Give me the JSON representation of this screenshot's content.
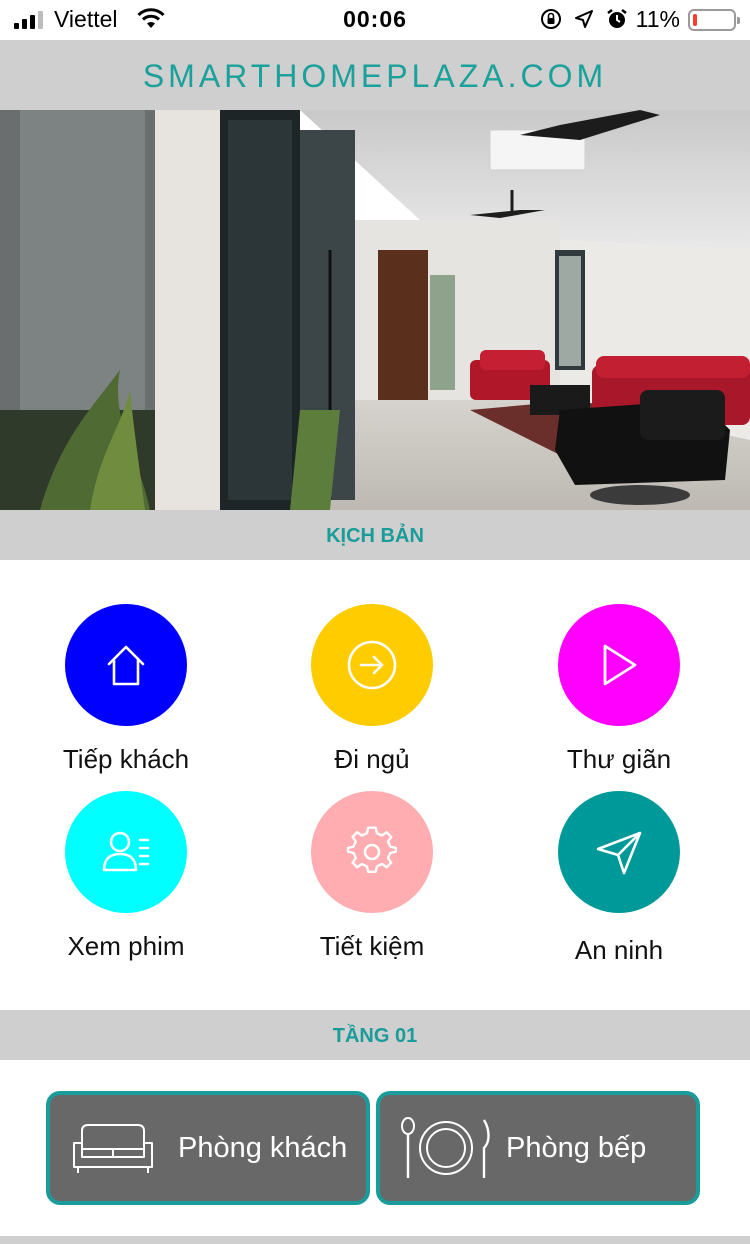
{
  "status_bar": {
    "carrier": "Viettel",
    "time": "00:06",
    "battery_percent": "11%",
    "battery_level": 0.11,
    "battery_color": "#ff3b30"
  },
  "brand": {
    "title": "SMARTHOMEPLAZA.COM",
    "color": "#1aa19c"
  },
  "hero": {
    "image": "living-room-photo"
  },
  "scenes_section": {
    "title": "KỊCH BẢN",
    "items": [
      {
        "label": "Tiếp khách",
        "icon": "home-icon",
        "color": "#0000ff"
      },
      {
        "label": "Đi ngủ",
        "icon": "arrow-right-circle-icon",
        "color": "#ffcc00"
      },
      {
        "label": "Thư giãn",
        "icon": "play-icon",
        "color": "#ff00ff"
      },
      {
        "label": "Xem phim",
        "icon": "contact-list-icon",
        "color": "#00ffff"
      },
      {
        "label": "Tiết kiệm",
        "icon": "gear-icon",
        "color": "#ffadb0"
      },
      {
        "label": "An ninh",
        "icon": "send-icon",
        "color": "#00999a"
      }
    ]
  },
  "floor_section": {
    "title": "TẦNG 01",
    "rooms": [
      {
        "label": "Phòng khách",
        "icon": "sofa-icon"
      },
      {
        "label": "Phòng bếp",
        "icon": "plate-cutlery-icon"
      }
    ]
  }
}
